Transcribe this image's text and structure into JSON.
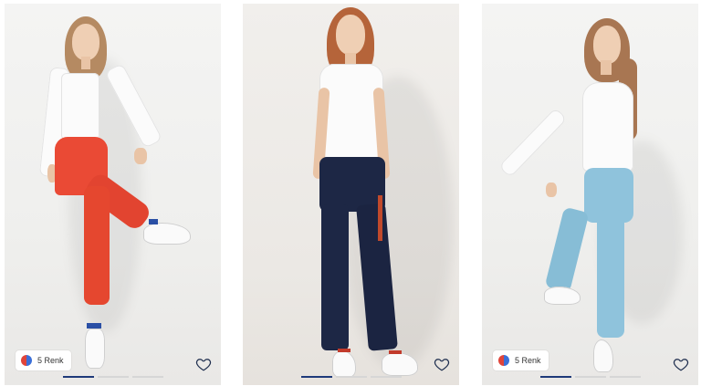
{
  "products": [
    {
      "color_count_label": "5 Renk",
      "favorite_icon": "heart-outline-icon",
      "slides": 3,
      "active_slide": 1,
      "pants_color": "#ea4a35"
    },
    {
      "color_count_label": "",
      "favorite_icon": "heart-outline-icon",
      "slides": 3,
      "active_slide": 1,
      "pants_color": "#1d2745"
    },
    {
      "color_count_label": "5 Renk",
      "favorite_icon": "heart-outline-icon",
      "slides": 3,
      "active_slide": 1,
      "pants_color": "#8fc3dc"
    }
  ],
  "colors": {
    "indicator_active": "#1f3a7a",
    "indicator_inactive": "#d6d6d6",
    "background": "#ffffff"
  }
}
